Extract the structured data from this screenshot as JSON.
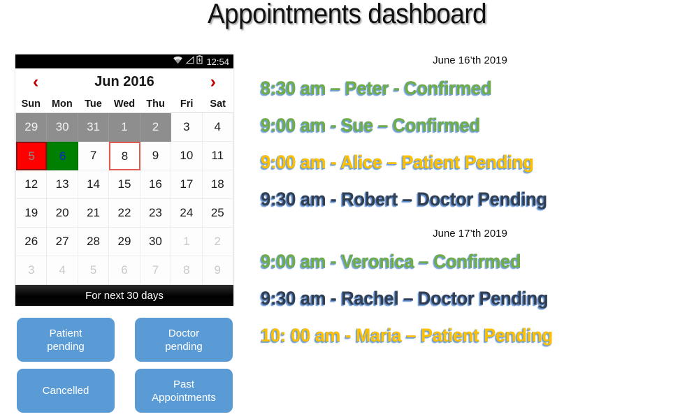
{
  "page": {
    "title": "Appointments dashboard"
  },
  "phone": {
    "status_bar": {
      "wifi_icon": "wifi-icon",
      "signal_icon": "signal-triangle-icon",
      "battery_icon": "battery-charging-icon",
      "clock": "12:54"
    },
    "calendar": {
      "prev_label": "‹",
      "next_label": "›",
      "month_label": "Jun 2016",
      "day_names": [
        "Sun",
        "Mon",
        "Tue",
        "Wed",
        "Thu",
        "Fri",
        "Sat"
      ],
      "weeks": [
        [
          {
            "day": "29",
            "state": "gray"
          },
          {
            "day": "30",
            "state": "gray"
          },
          {
            "day": "31",
            "state": "gray"
          },
          {
            "day": "1",
            "state": "gray"
          },
          {
            "day": "2",
            "state": "gray"
          },
          {
            "day": "3",
            "state": "normal"
          },
          {
            "day": "4",
            "state": "normal"
          }
        ],
        [
          {
            "day": "5",
            "state": "red"
          },
          {
            "day": "6",
            "state": "green"
          },
          {
            "day": "7",
            "state": "normal"
          },
          {
            "day": "8",
            "state": "outlined"
          },
          {
            "day": "9",
            "state": "normal"
          },
          {
            "day": "10",
            "state": "normal"
          },
          {
            "day": "11",
            "state": "normal"
          }
        ],
        [
          {
            "day": "12",
            "state": "normal"
          },
          {
            "day": "13",
            "state": "normal"
          },
          {
            "day": "14",
            "state": "normal"
          },
          {
            "day": "15",
            "state": "normal"
          },
          {
            "day": "16",
            "state": "normal"
          },
          {
            "day": "17",
            "state": "normal"
          },
          {
            "day": "18",
            "state": "normal"
          }
        ],
        [
          {
            "day": "19",
            "state": "normal"
          },
          {
            "day": "20",
            "state": "normal"
          },
          {
            "day": "21",
            "state": "normal"
          },
          {
            "day": "22",
            "state": "normal"
          },
          {
            "day": "23",
            "state": "normal"
          },
          {
            "day": "24",
            "state": "normal"
          },
          {
            "day": "25",
            "state": "normal"
          }
        ],
        [
          {
            "day": "26",
            "state": "normal"
          },
          {
            "day": "27",
            "state": "normal"
          },
          {
            "day": "28",
            "state": "normal"
          },
          {
            "day": "29",
            "state": "normal"
          },
          {
            "day": "30",
            "state": "normal"
          },
          {
            "day": "1",
            "state": "dim"
          },
          {
            "day": "2",
            "state": "dim"
          }
        ],
        [
          {
            "day": "3",
            "state": "dim"
          },
          {
            "day": "4",
            "state": "dim"
          },
          {
            "day": "5",
            "state": "dim"
          },
          {
            "day": "6",
            "state": "dim"
          },
          {
            "day": "7",
            "state": "dim"
          },
          {
            "day": "8",
            "state": "dim"
          },
          {
            "day": "9",
            "state": "dim"
          }
        ]
      ],
      "footer_label": "For next 30 days"
    }
  },
  "buttons": [
    {
      "label": "Patient\npending",
      "name": "patient-pending-button"
    },
    {
      "label": "Doctor\npending",
      "name": "doctor-pending-button"
    },
    {
      "label": "Cancelled",
      "name": "cancelled-button"
    },
    {
      "label": "Past\nAppointments",
      "name": "past-appointments-button"
    }
  ],
  "appointments": {
    "days": [
      {
        "heading": "June 16’th 2019",
        "items": [
          {
            "text": "8:30 am – Peter - Confirmed",
            "status": "confirmed"
          },
          {
            "text": "9:00 am - Sue – Confirmed",
            "status": "confirmed"
          },
          {
            "text": "9:00 am - Alice – Patient Pending",
            "status": "patient-pending"
          },
          {
            "text": "9:30 am - Robert – Doctor Pending",
            "status": "doctor-pending"
          }
        ]
      },
      {
        "heading": "June 17’th 2019",
        "items": [
          {
            "text": "9:00 am - Veronica – Confirmed",
            "status": "confirmed"
          },
          {
            "text": "9:30 am - Rachel – Doctor Pending",
            "status": "doctor-pending"
          },
          {
            "text": "10: 00 am - Maria – Patient Pending",
            "status": "patient-pending"
          }
        ]
      }
    ]
  },
  "colors": {
    "confirmed": "#70ad47",
    "patient_pending": "#ffc000",
    "doctor_pending": "#333f50",
    "button_blue": "#5b9bd5",
    "marked_red": "#ff0000",
    "marked_green": "#008000",
    "outline_red": "#e05a52",
    "muted_gray": "#8e8e8e"
  }
}
